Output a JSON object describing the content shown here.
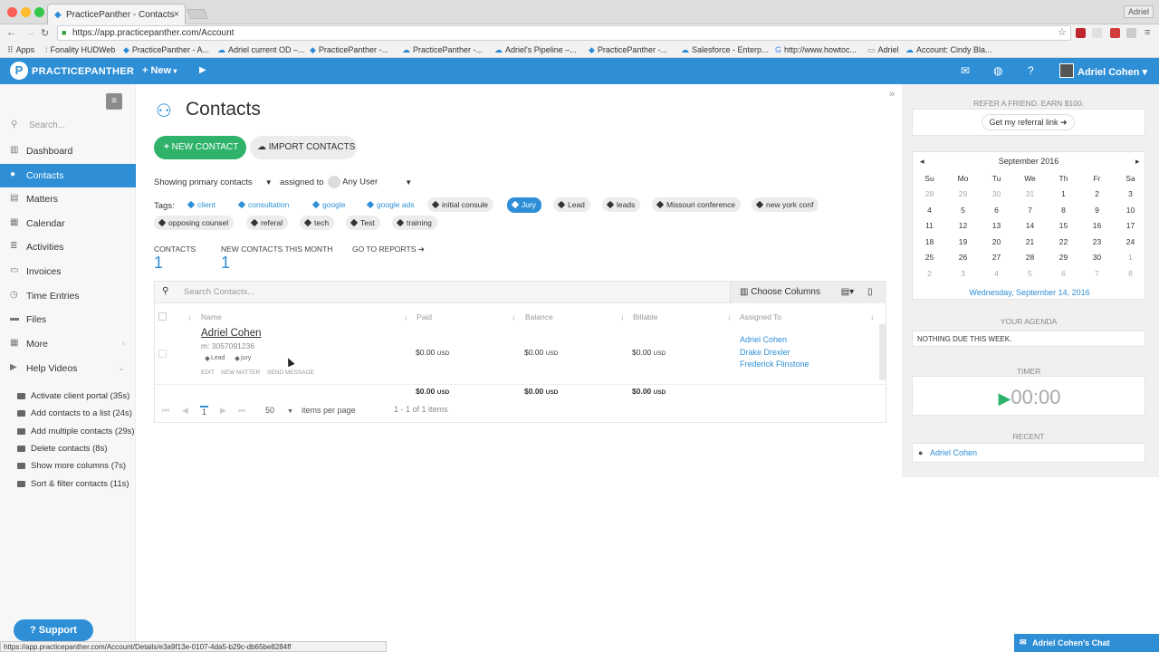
{
  "browser": {
    "tab_title": "PracticePanther - Contacts",
    "tab_close": "×",
    "profile": "Adriel",
    "url": "https://app.practicepanther.com/Account",
    "bookmarks": [
      "Apps",
      "Fonality HUDWeb",
      "PracticePanther - A...",
      "Adriel current OD –...",
      "PracticePanther -...",
      "PracticePanther -...",
      "Adriel's Pipeline –...",
      "PracticePanther -...",
      "Salesforce - Enterp...",
      "http://www.howtoc...",
      "Adriel",
      "Account: Cindy Bla..."
    ],
    "status_url": "https://app.practicepanther.com/Account/Details/e3a9f13e-0107-4da5-b29c-db65be8284ff"
  },
  "app": {
    "logo_text": "PRACTICEPANTHER",
    "new_label": "New",
    "user_name": "Adriel Cohen",
    "brand_color": "#2e8fd6"
  },
  "sidebar": {
    "search_placeholder": "Search...",
    "items": [
      {
        "label": "Dashboard",
        "icon": "dashboard-icon"
      },
      {
        "label": "Contacts",
        "icon": "contacts-icon"
      },
      {
        "label": "Matters",
        "icon": "briefcase-icon"
      },
      {
        "label": "Calendar",
        "icon": "calendar-icon"
      },
      {
        "label": "Activities",
        "icon": "activities-icon"
      },
      {
        "label": "Invoices",
        "icon": "invoice-icon"
      },
      {
        "label": "Time Entries",
        "icon": "clock-icon"
      },
      {
        "label": "Files",
        "icon": "folder-icon"
      },
      {
        "label": "More",
        "icon": "more-icon"
      },
      {
        "label": "Help Videos",
        "icon": "video-icon"
      }
    ],
    "help_videos": [
      "Activate client portal (35s)",
      "Add contacts to a list (24s)",
      "Add multiple contacts (29s)",
      "Delete contacts (8s)",
      "Show more columns (7s)",
      "Sort & filter contacts (11s)"
    ],
    "support_label": "Support"
  },
  "main": {
    "title": "Contacts",
    "new_contact": "NEW CONTACT",
    "import_contacts": "IMPORT CONTACTS",
    "showing_label": "Showing",
    "showing_value": "primary contacts",
    "assigned_label": "assigned to",
    "assigned_value": "Any User",
    "tags_label": "Tags:",
    "tags_row1": [
      {
        "label": "client",
        "style": "blue"
      },
      {
        "label": "consultation",
        "style": "blue"
      },
      {
        "label": "google",
        "style": "blue"
      },
      {
        "label": "google ads",
        "style": "blue"
      },
      {
        "label": "initial consule",
        "style": "gray"
      },
      {
        "label": "Jury",
        "style": "active"
      },
      {
        "label": "Lead",
        "style": "gray"
      },
      {
        "label": "leads",
        "style": "gray"
      },
      {
        "label": "Missouri conference",
        "style": "gray"
      },
      {
        "label": "new york conf",
        "style": "gray"
      }
    ],
    "tags_row2": [
      {
        "label": "opposing counsel",
        "style": "gray"
      },
      {
        "label": "referal",
        "style": "gray"
      },
      {
        "label": "tech",
        "style": "gray"
      },
      {
        "label": "Test",
        "style": "gray"
      },
      {
        "label": "training",
        "style": "gray"
      }
    ],
    "stats": {
      "contacts_label": "CONTACTS",
      "contacts_value": "1",
      "new_label": "NEW CONTACTS THIS MONTH",
      "new_value": "1",
      "reports_label": "GO TO REPORTS"
    },
    "table": {
      "search_placeholder": "Search Contacts...",
      "choose_columns": "Choose Columns",
      "headers": [
        "Name",
        "Paid",
        "Balance",
        "Billable",
        "Assigned To"
      ],
      "row": {
        "name": "Adriel Cohen",
        "phone": "m: 3057091236",
        "tags": [
          "Lead",
          "jury"
        ],
        "actions": [
          "EDIT",
          "NEW MATTER",
          "SEND MESSAGE"
        ],
        "paid": "$0.00",
        "balance": "$0.00",
        "billable": "$0.00",
        "currency": "USD",
        "assigned": [
          "Adriel Cohen",
          "Drake Drexler",
          "Frederick Flinstone"
        ]
      },
      "totals": {
        "paid": "$0.00",
        "balance": "$0.00",
        "billable": "$0.00",
        "currency": "USD"
      },
      "pager": {
        "page": "1",
        "per_page": "50",
        "per_page_label": "items per page",
        "summary": "1 - 1 of 1 items"
      }
    }
  },
  "right": {
    "referral_head": "REFER A FRIEND. EARN $100.",
    "referral_btn": "Get my referral link",
    "calendar": {
      "month": "September 2016",
      "days": [
        "Su",
        "Mo",
        "Tu",
        "We",
        "Th",
        "Fr",
        "Sa"
      ],
      "weeks": [
        [
          "28",
          "29",
          "30",
          "31",
          "1",
          "2",
          "3"
        ],
        [
          "4",
          "5",
          "6",
          "7",
          "8",
          "9",
          "10"
        ],
        [
          "11",
          "12",
          "13",
          "14",
          "15",
          "16",
          "17"
        ],
        [
          "18",
          "19",
          "20",
          "21",
          "22",
          "23",
          "24"
        ],
        [
          "25",
          "26",
          "27",
          "28",
          "29",
          "30",
          "1"
        ],
        [
          "2",
          "3",
          "4",
          "5",
          "6",
          "7",
          "8"
        ]
      ],
      "today": "Wednesday, September 14, 2016"
    },
    "agenda_head": "YOUR AGENDA",
    "agenda_text": "NOTHING DUE THIS WEEK.",
    "timer_head": "TIMER",
    "timer_value": "00:00",
    "recent_head": "RECENT",
    "recent_item": "Adriel Cohen"
  },
  "chat_label": "Adriel Cohen's Chat"
}
